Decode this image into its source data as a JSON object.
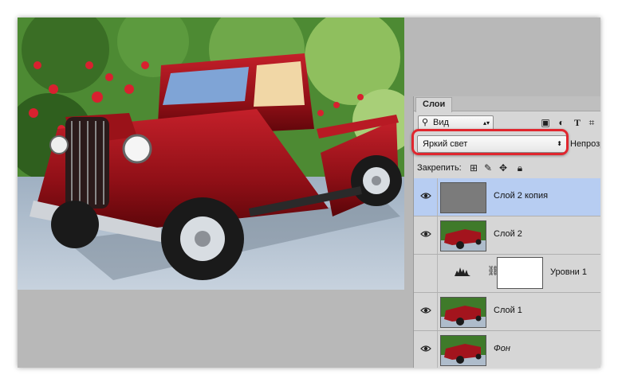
{
  "panel": {
    "tab_label": "Слои",
    "filter_kind": "Вид",
    "filter_icons": [
      "image-filter-icon",
      "adjustment-filter-icon",
      "type-filter-icon",
      "shape-filter-icon"
    ],
    "blend_mode": "Яркий свет",
    "opacity_label": "Непрозр",
    "lock_label": "Закрепить:",
    "lock_icons": [
      "lock-transparent-icon",
      "lock-paint-icon",
      "lock-position-icon",
      "lock-all-icon"
    ]
  },
  "layers": [
    {
      "name": "Слой 2 копия",
      "type": "gray",
      "selected": true
    },
    {
      "name": "Слой 2",
      "type": "car",
      "selected": false
    },
    {
      "name": "Уровни 1",
      "type": "adjustment",
      "selected": false
    },
    {
      "name": "Слой 1",
      "type": "car",
      "selected": false
    },
    {
      "name": "Фон",
      "type": "car",
      "selected": false
    }
  ],
  "colors": {
    "selected_row": "#b7cdf2",
    "highlight": "#e0262e",
    "panel_bg": "#d6d6d6"
  }
}
